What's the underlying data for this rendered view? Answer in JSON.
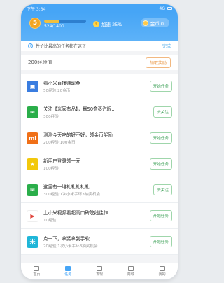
{
  "status_bar": {
    "time": "下午 3:34",
    "network": "4G"
  },
  "header": {
    "level": "5",
    "xp_text": "524/1400",
    "xp_progress": 0.374,
    "bonus_text": "加速 25%",
    "coins_text": "金币 0"
  },
  "banner": {
    "text": "性价比最高的任务都在这了",
    "action": "完成"
  },
  "xp_reward": {
    "label": "200经验值",
    "button": "领取奖励"
  },
  "tasks": [
    {
      "title": "看小米直播赚现金",
      "sub": "50经验,20金币",
      "button": "开始任务",
      "icon": "tv-icon",
      "color": "#3a7de0",
      "glyph": "▣"
    },
    {
      "title": "关注【米家有品】，赢50盒蒸汽眼...",
      "sub": "300经验",
      "button": "去关注",
      "icon": "wechat-icon",
      "color": "#2aae4a",
      "glyph": "✉"
    },
    {
      "title": "测测今天吃的好不好，领金币奖励",
      "sub": "200经验;100金币",
      "button": "开始任务",
      "icon": "mi-icon",
      "color": "#f07018",
      "glyph": "mi"
    },
    {
      "title": "新用户登录领一元",
      "sub": "100经验",
      "button": "开始任务",
      "icon": "gift-icon",
      "color": "#f2c80c",
      "glyph": "★"
    },
    {
      "title": "这里有一堆礼礼礼礼礼......",
      "sub": "300经验;1次小米手环3抽奖机会",
      "button": "去关注",
      "icon": "wechat-icon",
      "color": "#2aae4a",
      "glyph": "✉"
    },
    {
      "title": "上小米视频看超高口碑院线佳作",
      "sub": "10经验",
      "button": "开始任务",
      "icon": "play-icon",
      "color": "#ffffff",
      "glyph": "▶"
    },
    {
      "title": "点一下，拿奖拿到手软",
      "sub": "20经验;1次小米手环3抽奖机会",
      "button": "开始任务",
      "icon": "mi-app-icon",
      "color": "#1fb6d8",
      "glyph": "米"
    }
  ],
  "nav": [
    {
      "label": "首页",
      "active": false
    },
    {
      "label": "任务",
      "active": true
    },
    {
      "label": "发现",
      "active": false
    },
    {
      "label": "商城",
      "active": false
    },
    {
      "label": "我的",
      "active": false
    }
  ]
}
